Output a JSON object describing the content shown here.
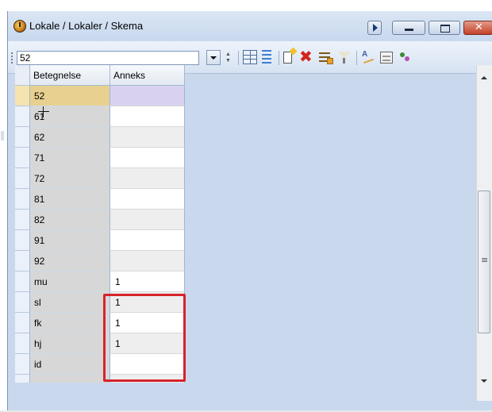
{
  "window": {
    "title": "Lokale / Lokaler / Skema",
    "close_glyph": "✕"
  },
  "toolbar": {
    "combo_value": "52",
    "icons": [
      "grid-icon",
      "rows-icon",
      "new-record-icon",
      "delete-icon",
      "edit-icon",
      "filter-icon",
      "sort-icon",
      "form-icon",
      "users-icon"
    ]
  },
  "grid": {
    "columns": [
      "Betegnelse",
      "Anneks"
    ],
    "rows": [
      {
        "betegnelse": "52",
        "anneks": ""
      },
      {
        "betegnelse": "61",
        "anneks": ""
      },
      {
        "betegnelse": "62",
        "anneks": ""
      },
      {
        "betegnelse": "71",
        "anneks": ""
      },
      {
        "betegnelse": "72",
        "anneks": ""
      },
      {
        "betegnelse": "81",
        "anneks": ""
      },
      {
        "betegnelse": "82",
        "anneks": ""
      },
      {
        "betegnelse": "91",
        "anneks": ""
      },
      {
        "betegnelse": "92",
        "anneks": ""
      },
      {
        "betegnelse": "mu",
        "anneks": "1"
      },
      {
        "betegnelse": "sl",
        "anneks": "1"
      },
      {
        "betegnelse": "fk",
        "anneks": "1"
      },
      {
        "betegnelse": "hj",
        "anneks": "1"
      },
      {
        "betegnelse": "id",
        "anneks": ""
      },
      {
        "betegnelse": "",
        "anneks": ""
      }
    ],
    "selected_row": 0
  },
  "colors": {
    "window_bg": "#c9d8ec",
    "selected_cell": "#e8d190",
    "highlight_box": "#d8232a"
  }
}
